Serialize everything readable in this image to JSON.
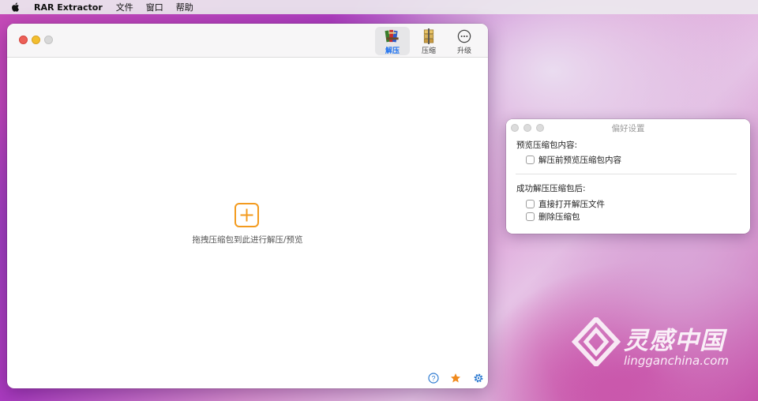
{
  "menubar": {
    "apple_icon": "apple-logo-icon",
    "app_name": "RAR Extractor",
    "menus": [
      "文件",
      "窗口",
      "帮助"
    ]
  },
  "main_window": {
    "toolbar": {
      "extract_label": "解压",
      "compress_label": "压缩",
      "upgrade_label": "升级",
      "active": "extract"
    },
    "drop_zone": {
      "hint": "拖拽压缩包到此进行解压/预览",
      "icon": "plus-icon",
      "accent": "#f39b1f"
    },
    "footer_icons": [
      "help-icon",
      "star-icon",
      "gear-icon"
    ]
  },
  "preferences": {
    "title": "偏好设置",
    "section1": {
      "heading": "预览压缩包内容:",
      "options": [
        {
          "label": "解压前预览压缩包内容",
          "checked": false
        }
      ]
    },
    "section2": {
      "heading": "成功解压压缩包后:",
      "options": [
        {
          "label": "直接打开解压文件",
          "checked": false
        },
        {
          "label": "删除压缩包",
          "checked": false
        }
      ]
    }
  },
  "watermark": {
    "cn": "灵感中国",
    "en": "lingganchina.com"
  },
  "colors": {
    "accent_blue": "#1a6ff0",
    "close": "#ec5f57",
    "minimize": "#f2be2f",
    "zoom": "#d8d8d8"
  }
}
